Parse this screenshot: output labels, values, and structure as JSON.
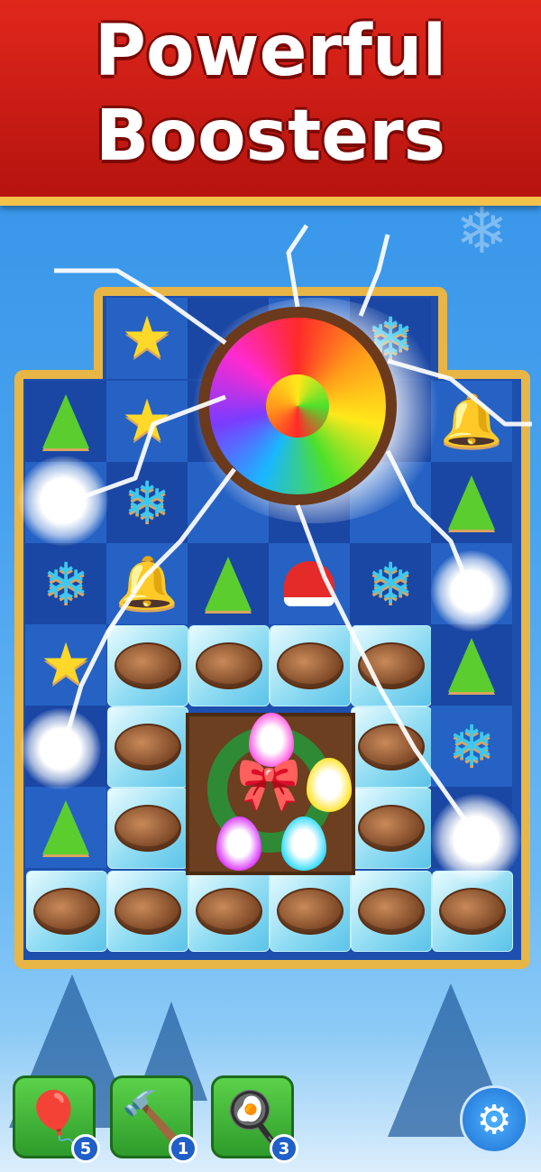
{
  "banner": {
    "line1": "Powerful",
    "line2": "Boosters"
  },
  "boosters": [
    {
      "name": "rainbow-ornament-bomb",
      "icon": "🎈",
      "count": "5"
    },
    {
      "name": "santa-belt-hammer",
      "icon": "🔨",
      "count": "1"
    },
    {
      "name": "spatula",
      "icon": "🍳",
      "count": "3"
    }
  ],
  "settings": {
    "icon": "gear-icon"
  },
  "colors": {
    "banner": "#c91a14",
    "board_frame": "#e8b547",
    "board_bg": "#1d4fae"
  }
}
